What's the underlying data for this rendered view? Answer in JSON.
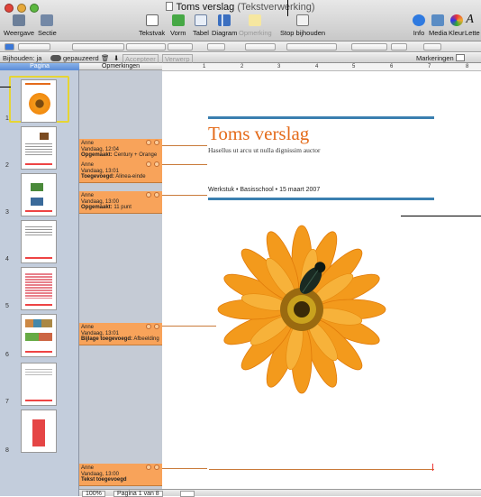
{
  "window": {
    "title": "Toms verslag",
    "app_suffix": "(Tekstverwerking)"
  },
  "toolbar": {
    "items": [
      {
        "label": "Weergave",
        "icon": "view-icon"
      },
      {
        "label": "Sectie",
        "icon": "section-icon"
      },
      {
        "label": "Tekstvak",
        "icon": "textbox-icon"
      },
      {
        "label": "Vorm",
        "icon": "shape-icon"
      },
      {
        "label": "Tabel",
        "icon": "table-icon"
      },
      {
        "label": "Diagram",
        "icon": "chart-icon"
      },
      {
        "label": "Opmerking",
        "icon": "comment-icon"
      },
      {
        "label": "Stop bijhouden",
        "icon": "track-stop-icon"
      },
      {
        "label": "Info",
        "icon": "info-icon"
      },
      {
        "label": "Media",
        "icon": "media-icon"
      },
      {
        "label": "Kleur",
        "icon": "color-icon"
      },
      {
        "label": "Lette",
        "icon": "font-icon"
      }
    ]
  },
  "trackbar": {
    "label": "Bijhouden: ja",
    "paused": "gepauzeerd",
    "accept": "Accepteer",
    "reject": "Verwerp",
    "markings": "Markeringen"
  },
  "pages_panel": {
    "header": "Pagina",
    "pages": [
      "1",
      "2",
      "3",
      "4",
      "5",
      "6",
      "7",
      "8"
    ]
  },
  "comments_panel": {
    "header": "Opmerkingen",
    "comments": [
      {
        "author": "Anne",
        "time": "Vandaag, 12:04",
        "action": "Opgemaakt:",
        "detail": "Century + Orange"
      },
      {
        "author": "Anne",
        "time": "Vandaag, 13:01",
        "action": "Toegevoegd:",
        "detail": "Alinea-einde"
      },
      {
        "author": "Anne",
        "time": "Vandaag, 13:00",
        "action": "Opgemaakt:",
        "detail": "11 punt"
      },
      {
        "author": "Anne",
        "time": "Vandaag, 13:01",
        "action": "Bijlage toegevoegd:",
        "detail": "Afbeelding"
      },
      {
        "author": "Anne",
        "time": "Vandaag, 13:00",
        "action": "Tekst toegevoegd",
        "detail": ""
      }
    ]
  },
  "document": {
    "title": "Toms verslag",
    "subtitle": "Hasellus ut arcu ut nulla dignissim auctor",
    "meta": "Werkstuk • Basisschool • 15 maart 2007",
    "ruler_numbers": [
      "1",
      "2",
      "3",
      "4",
      "5",
      "6",
      "7",
      "8"
    ]
  },
  "statusbar": {
    "zoom": "100%",
    "page_indicator": "Pagina 1 van 8"
  },
  "colors": {
    "accent_orange": "#e46b1a",
    "rule_blue": "#3a7fb0",
    "comment_bg": "#f8a35a"
  }
}
